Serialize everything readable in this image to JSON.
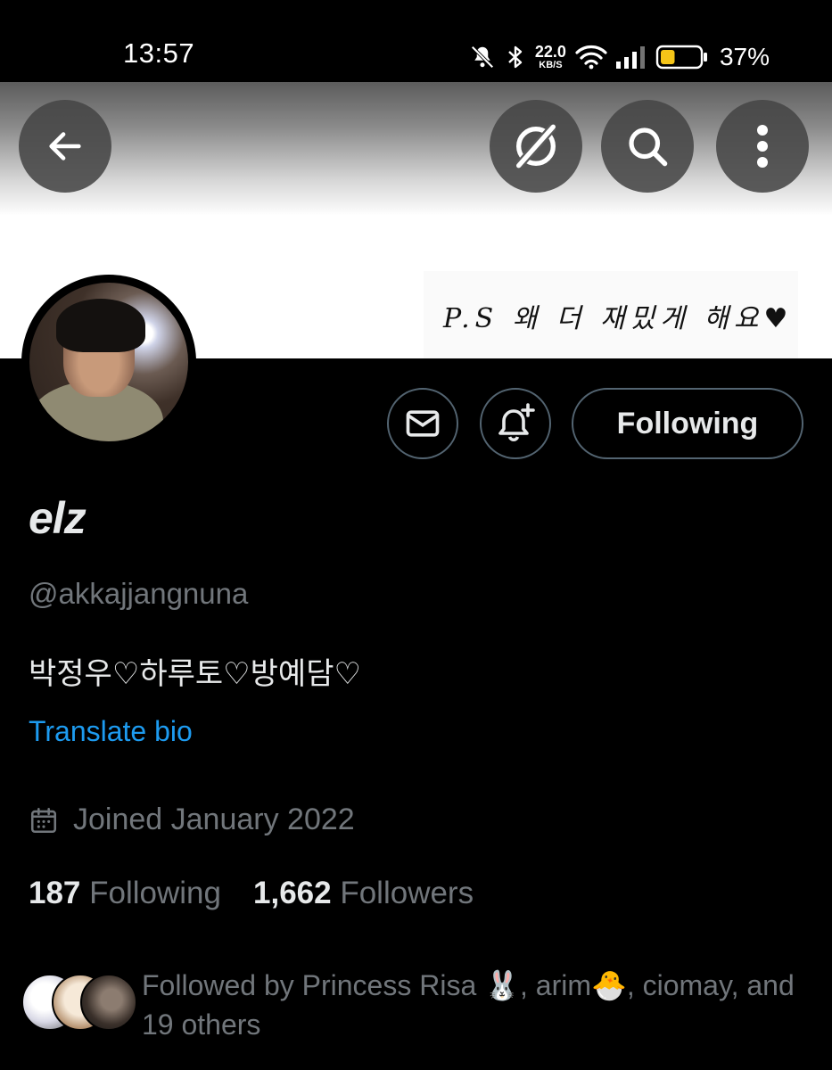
{
  "status_bar": {
    "time": "13:57",
    "net_speed_value": "22.0",
    "net_speed_unit": "KB/S",
    "battery_percent": "37%",
    "battery_level": 0.37,
    "battery_color": "#f5c518",
    "icons": [
      "bell-off-icon",
      "bluetooth-icon",
      "wifi-icon",
      "signal-icon",
      "battery-icon"
    ]
  },
  "header": {
    "banner_text": "P.S 왜 더 재밌게 해요♥",
    "buttons": [
      "back-arrow-icon",
      "grok-icon",
      "search-icon",
      "more-vertical-icon"
    ]
  },
  "profile": {
    "display_name": "elz",
    "handle": "@akkajjangnuna",
    "bio": "박정우♡하루토♡방예담♡",
    "translate_label": "Translate bio",
    "joined": "Joined January 2022",
    "following_count": "187",
    "following_label": "Following",
    "followers_count": "1,662",
    "followers_label": "Followers",
    "followed_by": "Followed by Princess Risa 🐰, arim🐣, ciomay, and 19 others"
  },
  "actions": {
    "following_button": "Following",
    "icons": [
      "mail-icon",
      "bell-plus-icon"
    ]
  },
  "colors": {
    "background": "#000000",
    "text_primary": "#e7e9ea",
    "text_secondary": "#71767b",
    "link": "#1d9bf0",
    "border": "#536471"
  }
}
